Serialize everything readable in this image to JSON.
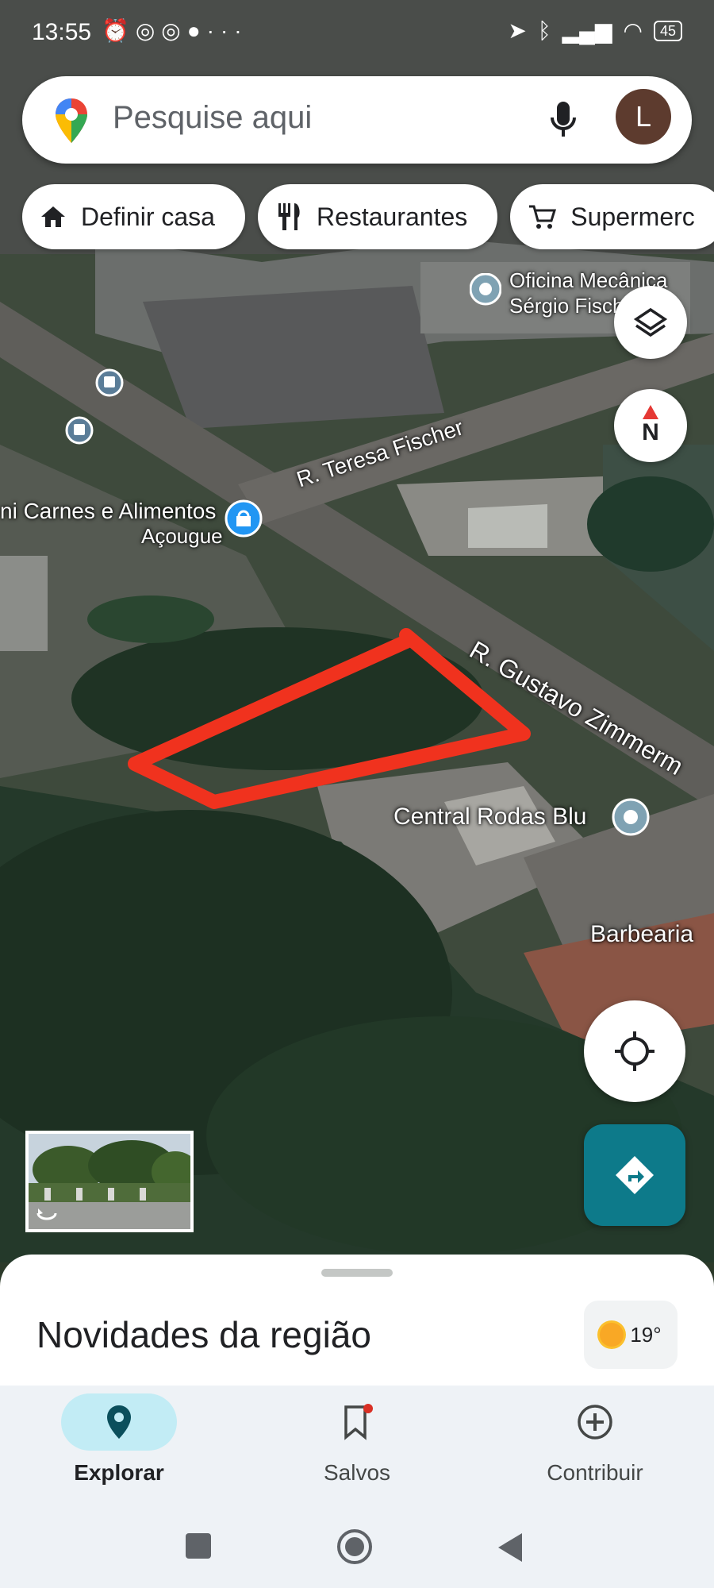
{
  "status_bar": {
    "time": "13:55",
    "battery": "45"
  },
  "search": {
    "placeholder": "Pesquise aqui",
    "avatar_letter": "L"
  },
  "chips": [
    {
      "label": "Definir casa",
      "icon": "home-icon"
    },
    {
      "label": "Restaurantes",
      "icon": "restaurant-icon"
    },
    {
      "label": "Supermerc",
      "icon": "cart-icon"
    }
  ],
  "map": {
    "labels": {
      "oficina_1": "Oficina Mecânica",
      "oficina_2": "Sérgio Fisch",
      "street_teresa": "R. Teresa Fischer",
      "carnes": "ni Carnes e Alimentos",
      "acougue": "Açougue",
      "street_gustavo": "R. Gustavo Zimmerm",
      "central_rodas": "Central Rodas Blu",
      "barbearia": "Barbearia"
    },
    "compass_letter": "N",
    "annotation_color": "#f0321e"
  },
  "sheet": {
    "title": "Novidades da região",
    "temperature": "19°"
  },
  "bottom_nav": [
    {
      "label": "Explorar",
      "icon": "location-pin-icon",
      "active": true
    },
    {
      "label": "Salvos",
      "icon": "bookmark-icon",
      "active": false
    },
    {
      "label": "Contribuir",
      "icon": "add-circle-icon",
      "active": false
    }
  ]
}
